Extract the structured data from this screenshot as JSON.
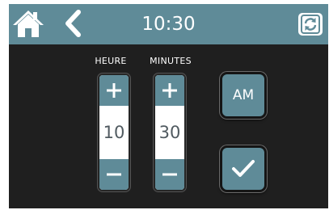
{
  "header": {
    "time": "10:30",
    "home_icon": "home-icon",
    "back_icon": "chevron-left-icon",
    "refresh_icon": "refresh-icon"
  },
  "hours": {
    "label": "HEURE",
    "value": "10",
    "increment_icon": "plus-icon",
    "decrement_icon": "minus-icon"
  },
  "minutes": {
    "label": "MINUTES",
    "value": "30",
    "increment_icon": "plus-icon",
    "decrement_icon": "minus-icon"
  },
  "ampm": {
    "label": "AM"
  },
  "confirm": {
    "icon": "checkmark-icon"
  },
  "colors": {
    "accent": "#5f8b98",
    "background": "#1f1f1f",
    "value_text": "#505a60"
  }
}
